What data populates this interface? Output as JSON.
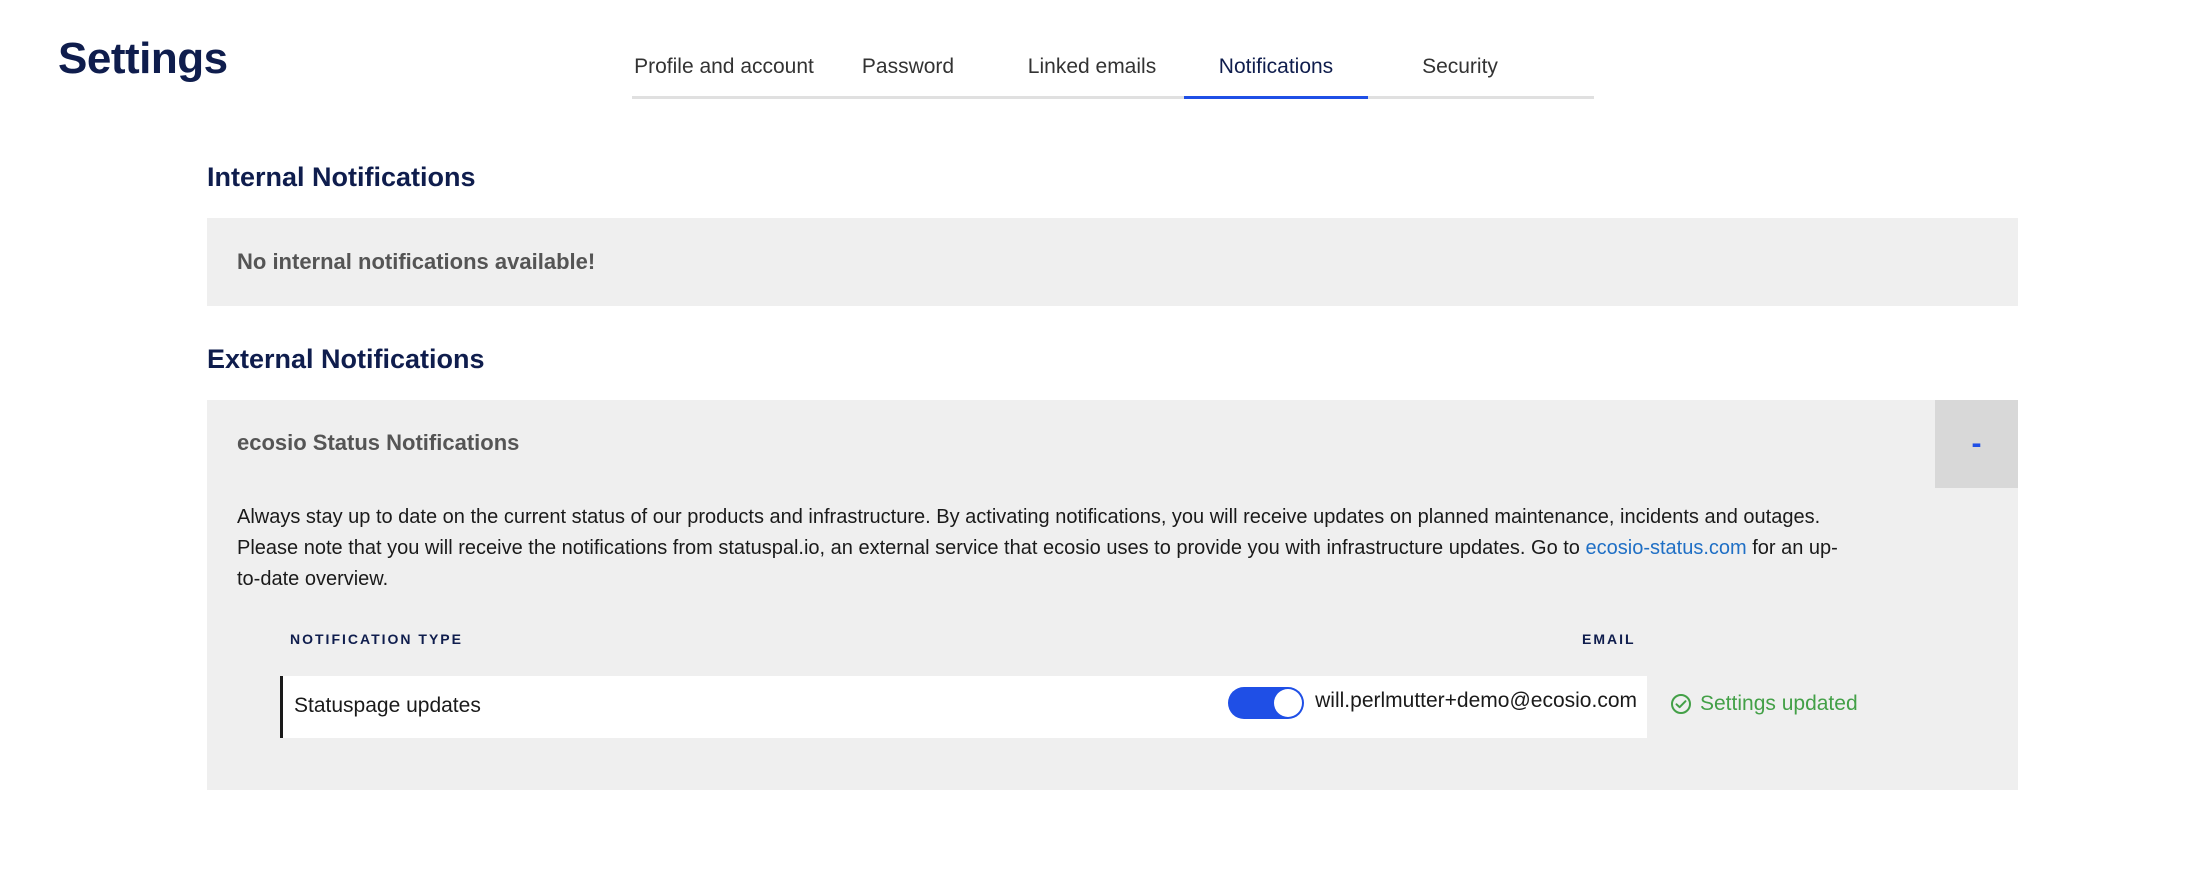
{
  "page": {
    "title": "Settings"
  },
  "tabs": [
    {
      "label": "Profile and account",
      "active": false
    },
    {
      "label": "Password",
      "active": false
    },
    {
      "label": "Linked emails",
      "active": false
    },
    {
      "label": "Notifications",
      "active": true
    },
    {
      "label": "Security",
      "active": false
    }
  ],
  "internal": {
    "heading": "Internal Notifications",
    "empty_message": "No internal notifications available!"
  },
  "external": {
    "heading": "External Notifications",
    "panel_title": "ecosio Status Notifications",
    "collapse_label": "-",
    "description_text": "Always stay up to date on the current status of our products and infrastructure. By activating notifications, you will receive updates on planned maintenance, incidents and outages. Please note that you will receive the notifications from statuspal.io, an external service that ecosio uses to provide you with infrastructure updates. Go to ",
    "description_link": "ecosio-status.com",
    "description_suffix": " for an up-to-date overview.",
    "columns": {
      "type": "NOTIFICATION TYPE",
      "email": "EMAIL"
    },
    "rows": [
      {
        "type": "Statuspage updates",
        "enabled": true,
        "email": "will.perlmutter+demo@ecosio.com"
      }
    ],
    "status_message": "Settings updated"
  },
  "icons": {
    "status": "check-circle-icon"
  },
  "colors": {
    "brand_navy": "#0f1d4d",
    "accent_blue": "#1f4fe6",
    "link_blue": "#1f6fc5",
    "success_green": "#43a047",
    "panel_gray": "#efefef"
  }
}
